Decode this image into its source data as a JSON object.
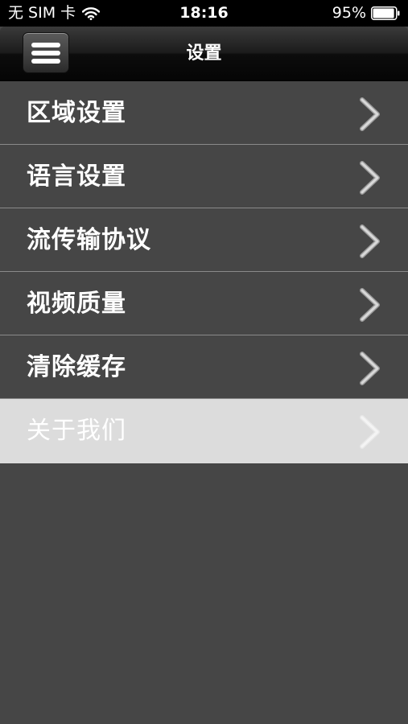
{
  "status_bar": {
    "carrier": "无 SIM 卡",
    "time": "18:16",
    "battery_percent": "95%",
    "battery_level": 0.95,
    "icons": [
      "wifi-icon",
      "battery-icon"
    ]
  },
  "nav_bar": {
    "title": "设置",
    "menu_icon": "hamburger-icon"
  },
  "settings": {
    "items": [
      {
        "label": "区域设置",
        "icon": "chevron-right-icon",
        "selected": false
      },
      {
        "label": "语言设置",
        "icon": "chevron-right-icon",
        "selected": false
      },
      {
        "label": "流传输协议",
        "icon": "chevron-right-icon",
        "selected": false
      },
      {
        "label": "视频质量",
        "icon": "chevron-right-icon",
        "selected": false
      },
      {
        "label": "清除缓存",
        "icon": "chevron-right-icon",
        "selected": false
      },
      {
        "label": "关于我们",
        "icon": "chevron-right-icon",
        "selected": true
      }
    ]
  },
  "colors": {
    "background": "#464646",
    "row_selected": "#dcdcdc",
    "separator": "#8a8a8a",
    "text": "#ffffff"
  }
}
